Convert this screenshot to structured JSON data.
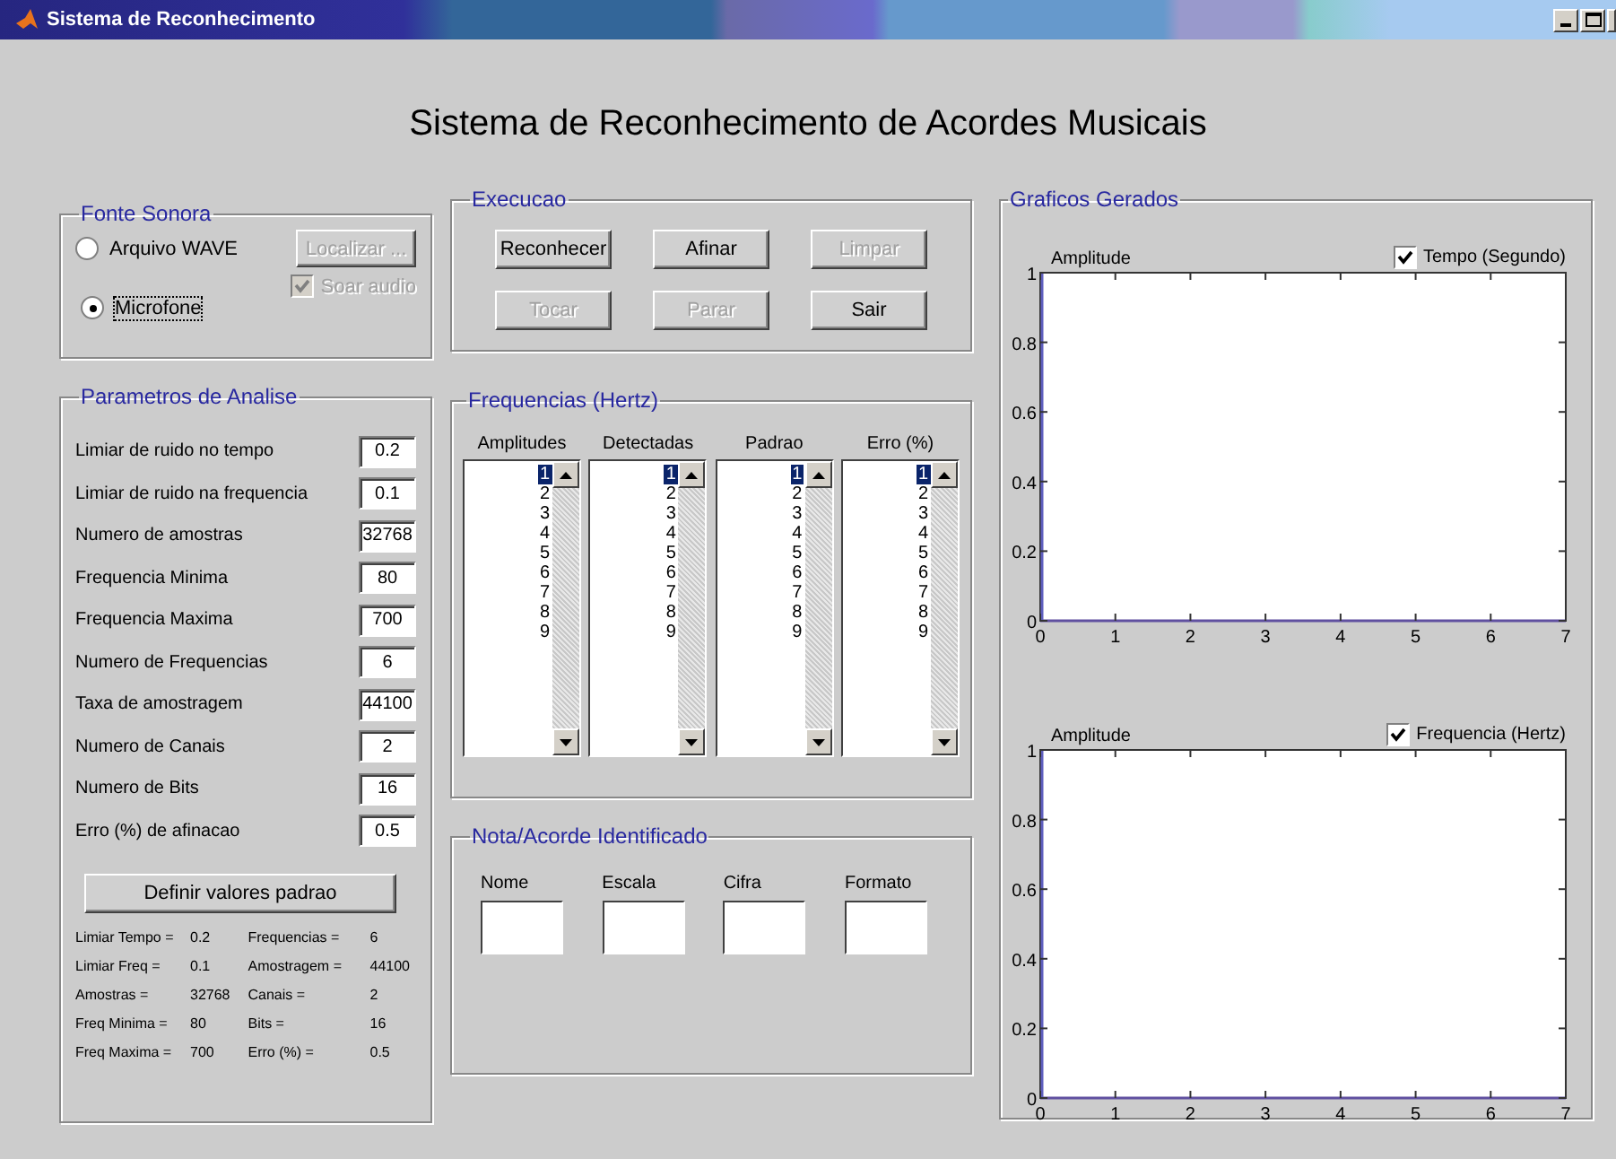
{
  "window": {
    "title": "Sistema de Reconhecimento"
  },
  "heading": "Sistema de Reconhecimento de Acordes Musicais",
  "fonte": {
    "title": "Fonte Sonora",
    "sources": [
      {
        "label": "Arquivo WAVE",
        "selected": false
      },
      {
        "label": "Microfone",
        "selected": true
      }
    ],
    "locate_button": {
      "label": "Localizar ...",
      "disabled": true
    },
    "play_audio": {
      "label": "Soar audio",
      "checked": true,
      "disabled": true
    }
  },
  "parametros": {
    "title": "Parametros de Analise",
    "fields": [
      {
        "label": "Limiar de ruido no tempo",
        "value": "0.2"
      },
      {
        "label": "Limiar de ruido na frequencia",
        "value": "0.1"
      },
      {
        "label": "Numero de amostras",
        "value": "32768"
      },
      {
        "label": "Frequencia Minima",
        "value": "80"
      },
      {
        "label": "Frequencia Maxima",
        "value": "700"
      },
      {
        "label": "Numero de Frequencias",
        "value": "6"
      },
      {
        "label": "Taxa de amostragem",
        "value": "44100"
      },
      {
        "label": "Numero de Canais",
        "value": "2"
      },
      {
        "label": "Numero de Bits",
        "value": "16"
      },
      {
        "label": "Erro (%) de afinacao",
        "value": "0.5"
      }
    ],
    "defaults_button": "Definir valores padrao",
    "summary": [
      [
        {
          "label": "Limiar Tempo =",
          "value": "0.2"
        },
        {
          "label": "Limiar Freq =",
          "value": "0.1"
        },
        {
          "label": "Amostras =",
          "value": "32768"
        },
        {
          "label": "Freq Minima =",
          "value": "80"
        },
        {
          "label": "Freq Maxima =",
          "value": "700"
        }
      ],
      [
        {
          "label": "Frequencias =",
          "value": "6"
        },
        {
          "label": "Amostragem =",
          "value": "44100"
        },
        {
          "label": "Canais =",
          "value": "2"
        },
        {
          "label": "Bits =",
          "value": "16"
        },
        {
          "label": "Erro (%) =",
          "value": "0.5"
        }
      ]
    ]
  },
  "execucao": {
    "title": "Execucao",
    "buttons": [
      {
        "label": "Reconhecer",
        "disabled": false
      },
      {
        "label": "Afinar",
        "disabled": false
      },
      {
        "label": "Limpar",
        "disabled": true
      },
      {
        "label": "Tocar",
        "disabled": true
      },
      {
        "label": "Parar",
        "disabled": true
      },
      {
        "label": "Sair",
        "disabled": false
      }
    ]
  },
  "frequencias": {
    "title": "Frequencias (Hertz)",
    "lists": [
      {
        "header": "Amplitudes",
        "items": [
          {
            "label": "1",
            "selected": true
          },
          {
            "label": "2",
            "selected": false
          },
          {
            "label": "3",
            "selected": false
          },
          {
            "label": "4",
            "selected": false
          },
          {
            "label": "5",
            "selected": false
          },
          {
            "label": "6",
            "selected": false
          },
          {
            "label": "7",
            "selected": false
          },
          {
            "label": "8",
            "selected": false
          },
          {
            "label": "9",
            "selected": false
          }
        ]
      },
      {
        "header": "Detectadas",
        "items": [
          {
            "label": "1",
            "selected": true
          },
          {
            "label": "2",
            "selected": false
          },
          {
            "label": "3",
            "selected": false
          },
          {
            "label": "4",
            "selected": false
          },
          {
            "label": "5",
            "selected": false
          },
          {
            "label": "6",
            "selected": false
          },
          {
            "label": "7",
            "selected": false
          },
          {
            "label": "8",
            "selected": false
          },
          {
            "label": "9",
            "selected": false
          }
        ]
      },
      {
        "header": "Padrao",
        "items": [
          {
            "label": "1",
            "selected": true
          },
          {
            "label": "2",
            "selected": false
          },
          {
            "label": "3",
            "selected": false
          },
          {
            "label": "4",
            "selected": false
          },
          {
            "label": "5",
            "selected": false
          },
          {
            "label": "6",
            "selected": false
          },
          {
            "label": "7",
            "selected": false
          },
          {
            "label": "8",
            "selected": false
          },
          {
            "label": "9",
            "selected": false
          }
        ]
      },
      {
        "header": "Erro (%)",
        "items": [
          {
            "label": "1",
            "selected": true
          },
          {
            "label": "2",
            "selected": false
          },
          {
            "label": "3",
            "selected": false
          },
          {
            "label": "4",
            "selected": false
          },
          {
            "label": "5",
            "selected": false
          },
          {
            "label": "6",
            "selected": false
          },
          {
            "label": "7",
            "selected": false
          },
          {
            "label": "8",
            "selected": false
          },
          {
            "label": "9",
            "selected": false
          }
        ]
      }
    ]
  },
  "nota": {
    "title": "Nota/Acorde Identificado",
    "fields": [
      "Nome",
      "Escala",
      "Cifra",
      "Formato"
    ]
  },
  "graficos": {
    "title": "Graficos Gerados",
    "charts": [
      {
        "toggle": {
          "label": "Tempo (Segundo)",
          "checked": true
        },
        "chart_data": {
          "type": "line",
          "ylabel": "Amplitude",
          "xlim": [
            0,
            7
          ],
          "ylim": [
            0,
            1
          ],
          "xticks": [
            0,
            1,
            2,
            3,
            4,
            5,
            6,
            7
          ],
          "yticks": [
            0,
            0.2,
            0.4,
            0.6,
            0.8,
            1
          ]
        }
      },
      {
        "toggle": {
          "label": "Frequencia (Hertz)",
          "checked": true
        },
        "chart_data": {
          "type": "line",
          "ylabel": "Amplitude",
          "xlim": [
            0,
            7
          ],
          "ylim": [
            0,
            1
          ],
          "xticks": [
            0,
            1,
            2,
            3,
            4,
            5,
            6,
            7
          ],
          "yticks": [
            0,
            0.2,
            0.4,
            0.6,
            0.8,
            1
          ]
        }
      }
    ]
  }
}
